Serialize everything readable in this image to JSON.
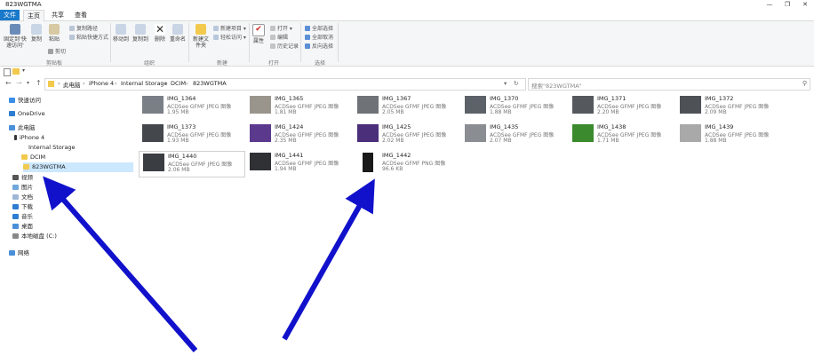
{
  "window": {
    "title": "823WGTMA"
  },
  "tabs": [
    {
      "label": "文件"
    },
    {
      "label": "主页"
    },
    {
      "label": "共享"
    },
    {
      "label": "查看"
    }
  ],
  "ribbon": {
    "pin_label": "固定到'快速访问'",
    "copy_label": "复制",
    "paste_label": "粘贴",
    "copy_path": "复制路径",
    "paste_shortcut": "粘贴快捷方式",
    "cut": "剪切",
    "move_to": "移动到",
    "copy_to": "复制到",
    "delete": "删除",
    "rename": "重命名",
    "new_folder": "新建文件夹",
    "new_item": "新建项目",
    "easy_access": "轻松访问",
    "properties": "属性",
    "open": "打开",
    "edit": "编辑",
    "history": "历史记录",
    "select_all": "全部选择",
    "select_none": "全部取消",
    "invert_selection": "反向选择",
    "group_clipboard": "剪贴板",
    "group_organize": "组织",
    "group_new": "新建",
    "group_open": "打开",
    "group_select": "选择"
  },
  "breadcrumb": [
    "此电脑",
    "iPhone 4",
    "Internal Storage",
    "DCIM",
    "823WGTMA"
  ],
  "search": {
    "placeholder": "搜索\"823WGTMA\""
  },
  "sidebar": {
    "items": [
      {
        "label": "快速访问"
      },
      {
        "label": "OneDrive"
      },
      {
        "label": "此电脑"
      },
      {
        "label": "iPhone 4"
      },
      {
        "label": "Internal Storage"
      },
      {
        "label": "DCIM"
      },
      {
        "label": "823WGTMA"
      },
      {
        "label": "视频"
      },
      {
        "label": "图片"
      },
      {
        "label": "文档"
      },
      {
        "label": "下载"
      },
      {
        "label": "音乐"
      },
      {
        "label": "桌面"
      },
      {
        "label": "本地磁盘 (C:)"
      },
      {
        "label": "网络"
      }
    ]
  },
  "files": [
    {
      "name": "IMG_1364",
      "type": "ACDSee GFMF JPEG 图像",
      "size": "1.95 MB",
      "color": "#7a7f86"
    },
    {
      "name": "IMG_1365",
      "type": "ACDSee GFMF JPEG 图像",
      "size": "1.81 MB",
      "color": "#9a958c"
    },
    {
      "name": "IMG_1367",
      "type": "ACDSee GFMF JPEG 图像",
      "size": "2.05 MB",
      "color": "#6f7378"
    },
    {
      "name": "IMG_1370",
      "type": "ACDSee GFMF JPEG 图像",
      "size": "1.88 MB",
      "color": "#5d6168"
    },
    {
      "name": "IMG_1371",
      "type": "ACDSee GFMF JPEG 图像",
      "size": "2.20 MB",
      "color": "#55595e"
    },
    {
      "name": "IMG_1372",
      "type": "ACDSee GFMF JPEG 图像",
      "size": "2.09 MB",
      "color": "#4e5257"
    },
    {
      "name": "IMG_1373",
      "type": "ACDSee GFMF JPEG 图像",
      "size": "1.93 MB",
      "color": "#44474b"
    },
    {
      "name": "IMG_1424",
      "type": "ACDSee GFMF JPEG 图像",
      "size": "2.35 MB",
      "color": "#5b3a8e"
    },
    {
      "name": "IMG_1425",
      "type": "ACDSee GFMF JPEG 图像",
      "size": "2.02 MB",
      "color": "#4b2f7a"
    },
    {
      "name": "IMG_1435",
      "type": "ACDSee GFMF JPEG 图像",
      "size": "2.07 MB",
      "color": "#8a8d91"
    },
    {
      "name": "IMG_1438",
      "type": "ACDSee GFMF JPEG 图像",
      "size": "1.71 MB",
      "color": "#3b8a2e"
    },
    {
      "name": "IMG_1439",
      "type": "ACDSee GFMF JPEG 图像",
      "size": "1.88 MB",
      "color": "#a9a9a9"
    },
    {
      "name": "IMG_1440",
      "type": "ACDSee GFMF JPEG 图像",
      "size": "2.06 MB",
      "color": "#3a3d41"
    },
    {
      "name": "IMG_1441",
      "type": "ACDSee GFMF JPEG 图像",
      "size": "1.94 MB",
      "color": "#2f3135"
    },
    {
      "name": "IMG_1442",
      "type": "ACDSee GFMF PNG 图像",
      "size": "96.6 KB",
      "color": "#1a1a1a"
    }
  ],
  "colors": {
    "accent": "#1979ca",
    "selection": "#cce8ff",
    "arrow": "#1111cc"
  }
}
